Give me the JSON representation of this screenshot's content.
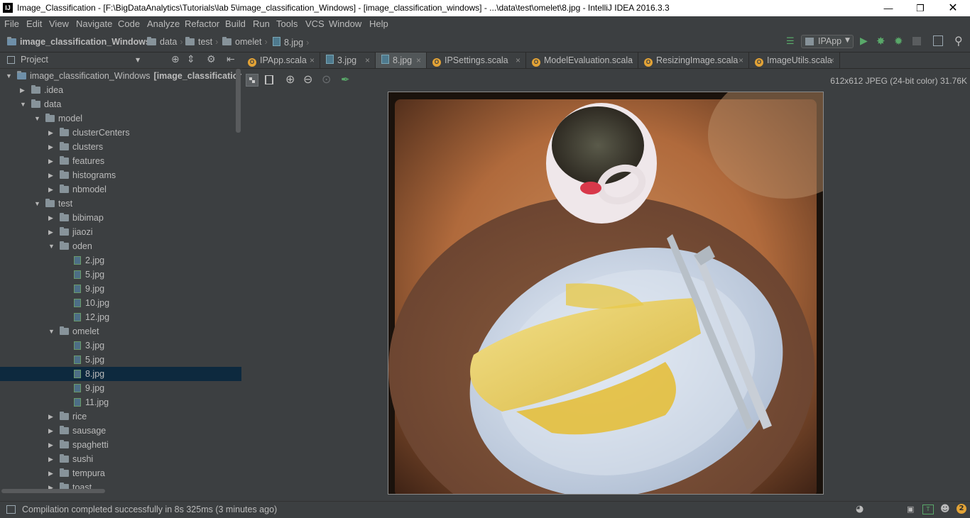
{
  "window": {
    "title": "Image_Classification - [F:\\BigDataAnalytics\\Tutorials\\lab 5\\image_classification_Windows] - [image_classification_windows] - ...\\data\\test\\omelet\\8.jpg - IntelliJ IDEA 2016.3.3",
    "app_icon": "IJ"
  },
  "menu": [
    "File",
    "Edit",
    "View",
    "Navigate",
    "Code",
    "Analyze",
    "Refactor",
    "Build",
    "Run",
    "Tools",
    "VCS",
    "Window",
    "Help"
  ],
  "breadcrumb": [
    "image_classification_Windows",
    "data",
    "test",
    "omelet",
    "8.jpg"
  ],
  "run_config": "IPApp",
  "project_panel": {
    "title": "Project"
  },
  "tree": [
    {
      "label": "image_classification_Windows",
      "suffix": "[image_classification_wi",
      "depth": 0,
      "type": "module",
      "expanded": true
    },
    {
      "label": ".idea",
      "depth": 1,
      "type": "folder",
      "expanded": false
    },
    {
      "label": "data",
      "depth": 1,
      "type": "folder",
      "expanded": true
    },
    {
      "label": "model",
      "depth": 2,
      "type": "folder",
      "expanded": true
    },
    {
      "label": "clusterCenters",
      "depth": 3,
      "type": "folder",
      "expanded": false
    },
    {
      "label": "clusters",
      "depth": 3,
      "type": "folder",
      "expanded": false
    },
    {
      "label": "features",
      "depth": 3,
      "type": "folder",
      "expanded": false
    },
    {
      "label": "histograms",
      "depth": 3,
      "type": "folder",
      "expanded": false
    },
    {
      "label": "nbmodel",
      "depth": 3,
      "type": "folder",
      "expanded": false
    },
    {
      "label": "test",
      "depth": 2,
      "type": "folder",
      "expanded": true
    },
    {
      "label": "bibimap",
      "depth": 3,
      "type": "folder",
      "expanded": false
    },
    {
      "label": "jiaozi",
      "depth": 3,
      "type": "folder",
      "expanded": false
    },
    {
      "label": "oden",
      "depth": 3,
      "type": "folder",
      "expanded": true
    },
    {
      "label": "2.jpg",
      "depth": 4,
      "type": "file"
    },
    {
      "label": "5.jpg",
      "depth": 4,
      "type": "file"
    },
    {
      "label": "9.jpg",
      "depth": 4,
      "type": "file"
    },
    {
      "label": "10.jpg",
      "depth": 4,
      "type": "file"
    },
    {
      "label": "12.jpg",
      "depth": 4,
      "type": "file"
    },
    {
      "label": "omelet",
      "depth": 3,
      "type": "folder",
      "expanded": true
    },
    {
      "label": "3.jpg",
      "depth": 4,
      "type": "file"
    },
    {
      "label": "5.jpg",
      "depth": 4,
      "type": "file"
    },
    {
      "label": "8.jpg",
      "depth": 4,
      "type": "file",
      "selected": true
    },
    {
      "label": "9.jpg",
      "depth": 4,
      "type": "file"
    },
    {
      "label": "11.jpg",
      "depth": 4,
      "type": "file"
    },
    {
      "label": "rice",
      "depth": 3,
      "type": "folder",
      "expanded": false
    },
    {
      "label": "sausage",
      "depth": 3,
      "type": "folder",
      "expanded": false
    },
    {
      "label": "spaghetti",
      "depth": 3,
      "type": "folder",
      "expanded": false
    },
    {
      "label": "sushi",
      "depth": 3,
      "type": "folder",
      "expanded": false
    },
    {
      "label": "tempura",
      "depth": 3,
      "type": "folder",
      "expanded": false
    },
    {
      "label": "toast",
      "depth": 3,
      "type": "folder",
      "expanded": false
    }
  ],
  "tabs": [
    {
      "label": "IPApp.scala",
      "icon": "scala-object-icon"
    },
    {
      "label": "3.jpg",
      "icon": "image-file-icon"
    },
    {
      "label": "8.jpg",
      "icon": "image-file-icon",
      "active": true
    },
    {
      "label": "IPSettings.scala",
      "icon": "scala-object-icon"
    },
    {
      "label": "ModelEvaluation.scala",
      "icon": "scala-object-icon"
    },
    {
      "label": "ResizingImage.scala",
      "icon": "scala-object-icon"
    },
    {
      "label": "ImageUtils.scala",
      "icon": "scala-object-icon"
    }
  ],
  "image_info": "612x612 JPEG (24-bit color) 31.76K",
  "status": {
    "message": "Compilation completed successfully in 8s 325ms (3 minutes ago)",
    "notification_count": "2"
  },
  "colors": {
    "bg": "#3c3f41",
    "selection": "#0d293e",
    "run_green": "#59a869",
    "scala_orange": "#e3a336"
  }
}
